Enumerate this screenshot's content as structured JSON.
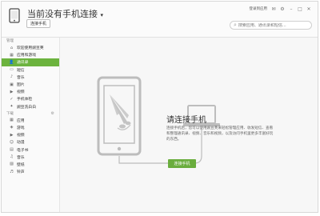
{
  "header": {
    "title": "当前没有手机连接",
    "connect_button": "连接手机",
    "login_link": "登录到应用",
    "search_placeholder": "搜索应用、通讯录和短信..."
  },
  "sidebar": {
    "section_manage": "管理",
    "manage_items": [
      {
        "label": "欢迎使用豌豆荚",
        "icon": "home-icon",
        "active": false
      },
      {
        "label": "应用和游戏",
        "icon": "apps-icon",
        "active": false
      },
      {
        "label": "通讯录",
        "icon": "contacts-icon",
        "active": true
      },
      {
        "label": "短信",
        "icon": "sms-icon",
        "active": false
      },
      {
        "label": "音乐",
        "icon": "music-icon",
        "active": false
      },
      {
        "label": "图片",
        "icon": "photo-icon",
        "active": false
      },
      {
        "label": "视频",
        "icon": "video-icon",
        "active": false
      },
      {
        "label": "手机体检",
        "icon": "checkup-icon",
        "active": false
      },
      {
        "label": "豌豆洗白白",
        "icon": "clean-icon",
        "active": false
      }
    ],
    "section_download": "下载",
    "download_items": [
      {
        "label": "应用",
        "icon": "app-download-icon"
      },
      {
        "label": "游戏",
        "icon": "game-icon"
      },
      {
        "label": "视频",
        "icon": "video-download-icon"
      },
      {
        "label": "动漫",
        "icon": "anime-icon"
      },
      {
        "label": "电子书",
        "icon": "ebook-icon"
      },
      {
        "label": "音乐",
        "icon": "music-download-icon"
      },
      {
        "label": "壁纸",
        "icon": "wallpaper-icon"
      },
      {
        "label": "铃声",
        "icon": "ringtone-icon"
      }
    ]
  },
  "main": {
    "title": "请连接手机",
    "body": "连接手机后，您可以使用豌豆荚来轻松管理应用、收发短信、查看和整理通讯录、视频、音乐和视频，以及访问手机里更多丰富好玩的东西。",
    "connect_button": "连接手机"
  },
  "colors": {
    "accent": "#6cb33e",
    "illustration_gray": "#bdbdbd"
  }
}
